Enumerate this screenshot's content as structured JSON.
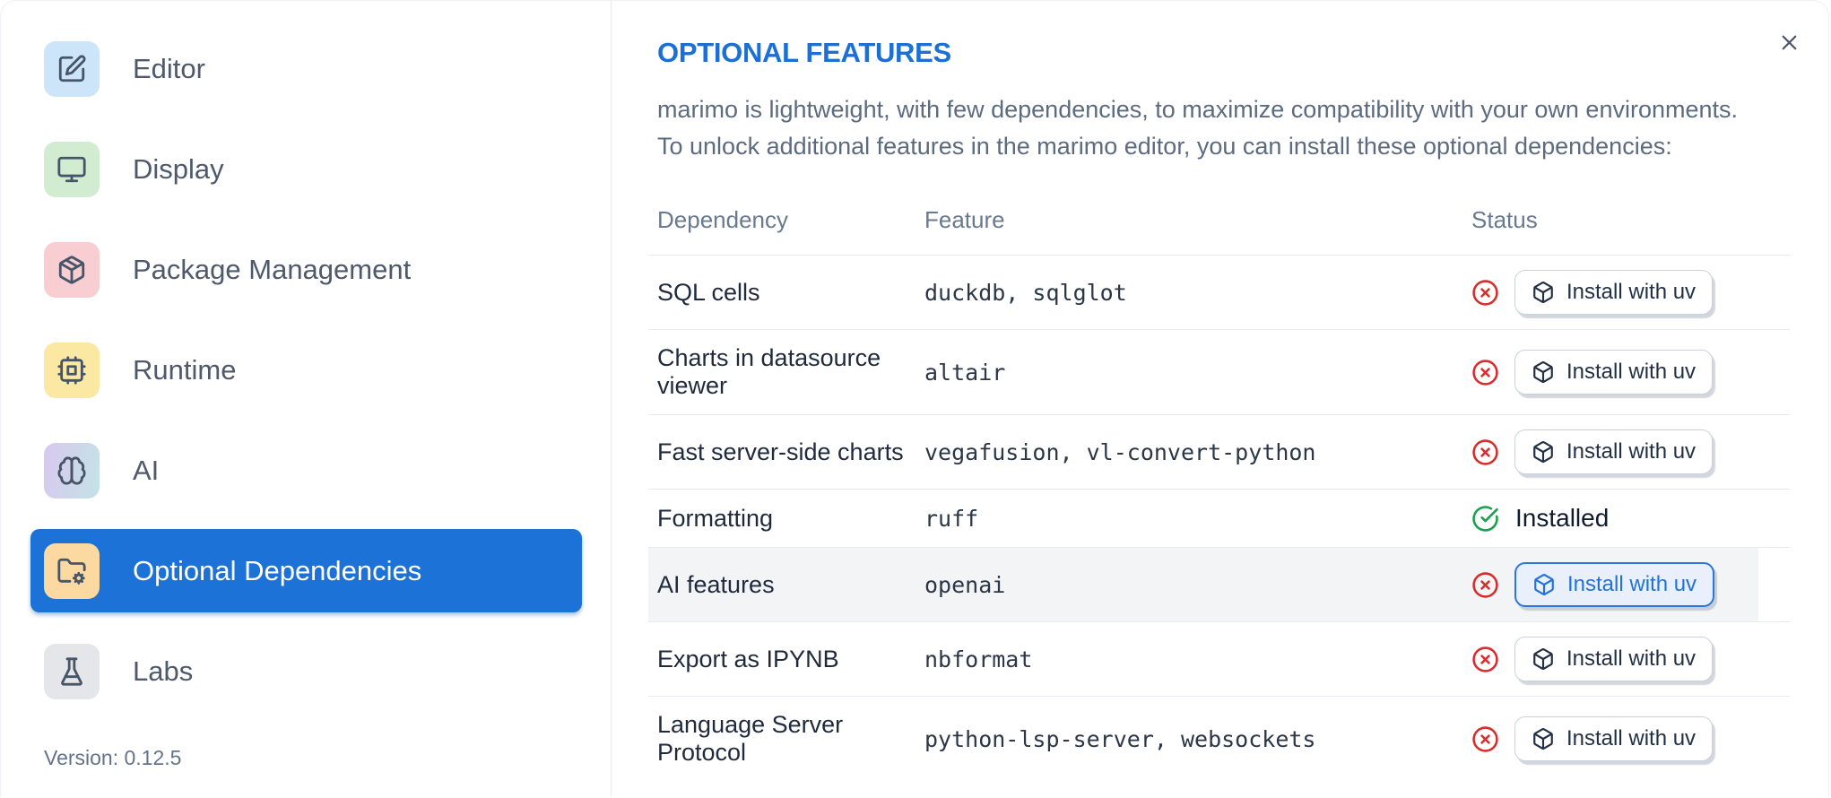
{
  "colors": {
    "accent": "#1d72d8",
    "title_blue": "#1c6fd4",
    "danger": "#d92c2c",
    "success": "#1ba14c"
  },
  "sidebar": {
    "items": [
      {
        "label": "Editor",
        "icon": "edit-icon",
        "icon_bg": "#cde5f9",
        "selected": false
      },
      {
        "label": "Display",
        "icon": "monitor-icon",
        "icon_bg": "#d2ecd2",
        "selected": false
      },
      {
        "label": "Package Management",
        "icon": "package-icon",
        "icon_bg": "#f9ced2",
        "selected": false
      },
      {
        "label": "Runtime",
        "icon": "cpu-icon",
        "icon_bg": "#fbe8a3",
        "selected": false
      },
      {
        "label": "AI",
        "icon": "brain-icon",
        "icon_bg": "linear-gradient(100deg,#d9c8ef 0%,#c3e3e6 100%)",
        "selected": false
      },
      {
        "label": "Optional Dependencies",
        "icon": "folder-gear-icon",
        "icon_bg": "#fbd9a1",
        "selected": true
      },
      {
        "label": "Labs",
        "icon": "flask-icon",
        "icon_bg": "#e4e6e9",
        "selected": false
      }
    ],
    "version_label": "Version: 0.12.5"
  },
  "panel": {
    "title": "OPTIONAL FEATURES",
    "description": [
      "marimo is lightweight, with few dependencies, to maximize compatibility with your own environments.",
      "To unlock additional features in the marimo editor, you can install these optional dependencies:"
    ],
    "close_icon": "close-icon"
  },
  "table": {
    "columns": [
      "Dependency",
      "Feature",
      "Status"
    ],
    "install_button_label": "Install with uv",
    "installed_label": "Installed",
    "status_icons": {
      "not-installed": "circle-x-icon",
      "installed": "circle-check-icon"
    },
    "button_icon": "box-icon",
    "rows": [
      {
        "dependency": "SQL cells",
        "feature": "duckdb, sqlglot",
        "status": "not-installed",
        "highlighted": false
      },
      {
        "dependency": "Charts in datasource viewer",
        "feature": "altair",
        "status": "not-installed",
        "highlighted": false
      },
      {
        "dependency": "Fast server-side charts",
        "feature": "vegafusion, vl-convert-python",
        "status": "not-installed",
        "highlighted": false
      },
      {
        "dependency": "Formatting",
        "feature": "ruff",
        "status": "installed",
        "highlighted": false
      },
      {
        "dependency": "AI features",
        "feature": "openai",
        "status": "not-installed",
        "highlighted": true
      },
      {
        "dependency": "Export as IPYNB",
        "feature": "nbformat",
        "status": "not-installed",
        "highlighted": false
      },
      {
        "dependency": "Language Server Protocol",
        "feature": "python-lsp-server, websockets",
        "status": "not-installed",
        "highlighted": false
      }
    ]
  }
}
